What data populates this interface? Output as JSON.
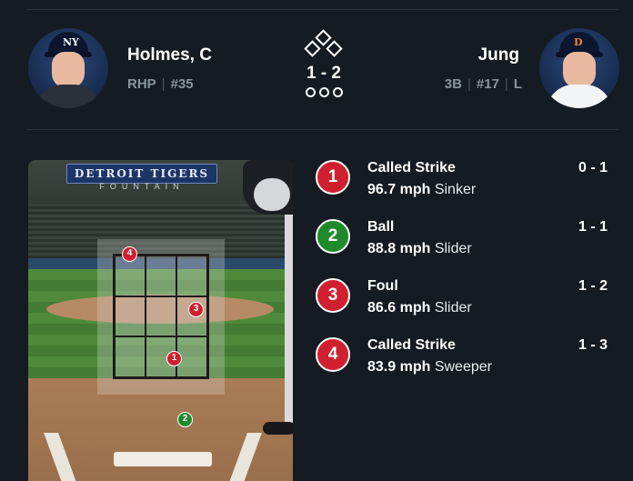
{
  "pitcher": {
    "name": "Holmes, C",
    "throws": "RHP",
    "number": "#35",
    "team_logo": "NY"
  },
  "batter": {
    "name": "Jung",
    "position": "3B",
    "number": "#17",
    "bats": "L",
    "team_logo": "D"
  },
  "count": "1 - 2",
  "field": {
    "sign": "DETROIT TIGERS",
    "sign_sub": "FOUNTAIN"
  },
  "colors": {
    "strike": "#d0202f",
    "ball": "#1f8a2c",
    "background": "#141b22"
  },
  "pitches": [
    {
      "num": "1",
      "result": "Called Strike",
      "speed": "96.7 mph",
      "type": "Sinker",
      "count": "0 - 1",
      "kind": "strike"
    },
    {
      "num": "2",
      "result": "Ball",
      "speed": "88.8 mph",
      "type": "Slider",
      "count": "1 - 1",
      "kind": "ball"
    },
    {
      "num": "3",
      "result": "Foul",
      "speed": "86.6 mph",
      "type": "Slider",
      "count": "1 - 2",
      "kind": "strike"
    },
    {
      "num": "4",
      "result": "Called Strike",
      "speed": "83.9 mph",
      "type": "Sweeper",
      "count": "1 - 3",
      "kind": "strike"
    }
  ]
}
